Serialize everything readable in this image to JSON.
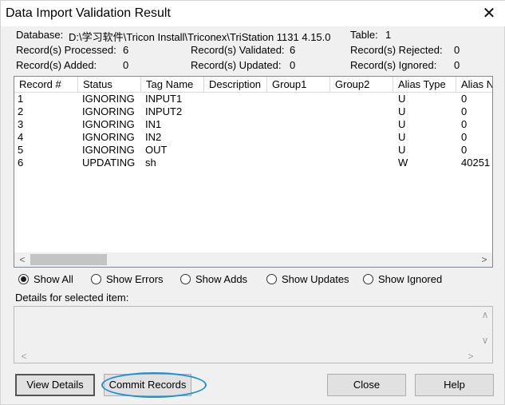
{
  "window": {
    "title": "Data Import Validation Result",
    "close_glyph": "✕"
  },
  "summary": {
    "database_label": "Database:",
    "database_value": "D:\\学习软件\\Tricon Install\\Triconex\\TriStation 1131 4.15.0",
    "table_label": "Table:",
    "table_value": "1",
    "processed_label": "Record(s) Processed:",
    "processed_value": "6",
    "validated_label": "Record(s) Validated:",
    "validated_value": "6",
    "rejected_label": "Record(s) Rejected:",
    "rejected_value": "0",
    "added_label": "Record(s) Added:",
    "added_value": "0",
    "updated_label": "Record(s) Updated:",
    "updated_value": "0",
    "ignored_label": "Record(s) Ignored:",
    "ignored_value": "0"
  },
  "grid": {
    "columns": [
      "Record #",
      "Status",
      "Tag Name",
      "Description",
      "Group1",
      "Group2",
      "Alias Type",
      "Alias N"
    ],
    "rows": [
      [
        "1",
        "IGNORING",
        "INPUT1",
        "",
        "",
        "",
        "U",
        "0"
      ],
      [
        "2",
        "IGNORING",
        "INPUT2",
        "",
        "",
        "",
        "U",
        "0"
      ],
      [
        "3",
        "IGNORING",
        "IN1",
        "",
        "",
        "",
        "U",
        "0"
      ],
      [
        "4",
        "IGNORING",
        "IN2",
        "",
        "",
        "",
        "U",
        "0"
      ],
      [
        "5",
        "IGNORING",
        "OUT",
        "",
        "",
        "",
        "U",
        "0"
      ],
      [
        "6",
        "UPDATING",
        "sh",
        "",
        "",
        "",
        "W",
        "40251"
      ]
    ],
    "scroll_left_glyph": "<",
    "scroll_right_glyph": ">"
  },
  "filters": {
    "selected": "Show All",
    "options": [
      "Show All",
      "Show Errors",
      "Show Adds",
      "Show Updates",
      "Show Ignored"
    ]
  },
  "details": {
    "label": "Details for selected item:",
    "up_glyph": "∧",
    "down_glyph": "∨",
    "left_glyph": "<",
    "right_glyph": ">"
  },
  "buttons": {
    "view_details": "View Details",
    "commit_records": "Commit Records",
    "close": "Close",
    "help": "Help"
  },
  "colors": {
    "highlight": "#1b8fd8"
  }
}
